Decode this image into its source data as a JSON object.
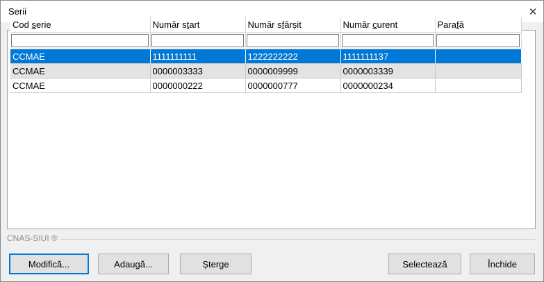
{
  "window": {
    "title": "Serii",
    "close_glyph": "✕"
  },
  "grid": {
    "columns": [
      {
        "pre": "Cod ",
        "ul": "s",
        "post": "erie"
      },
      {
        "pre": "Număr s",
        "ul": "t",
        "post": "art"
      },
      {
        "pre": "Număr s",
        "ul": "f",
        "post": "ârșit"
      },
      {
        "pre": "Număr ",
        "ul": "c",
        "post": "urent"
      },
      {
        "pre": "Para",
        "ul": "f",
        "post": "ă"
      }
    ],
    "filters": [
      "",
      "",
      "",
      "",
      ""
    ],
    "rows": [
      {
        "cod": "CCMAE",
        "start": "1111111111",
        "sfarsit": "1222222222",
        "curent": "1111111137",
        "parafa": "",
        "state": "selected"
      },
      {
        "cod": "CCMAE",
        "start": "0000003333",
        "sfarsit": "0000009999",
        "curent": "0000003339",
        "parafa": "",
        "state": "alternate"
      },
      {
        "cod": "CCMAE",
        "start": "0000000222",
        "sfarsit": "0000000777",
        "curent": "0000000234",
        "parafa": "",
        "state": "normal"
      }
    ]
  },
  "footer": {
    "label": "CNAS-SIUI ®"
  },
  "buttons": {
    "modifica": "Modifică...",
    "adauga": "Adaugă...",
    "sterge": "Șterge",
    "selecteaza": "Selectează",
    "inchide": "Închide"
  },
  "colors": {
    "selection": "#0078d7",
    "alternate_row": "#e3e3e3",
    "dialog_background": "#f0f0f0"
  }
}
